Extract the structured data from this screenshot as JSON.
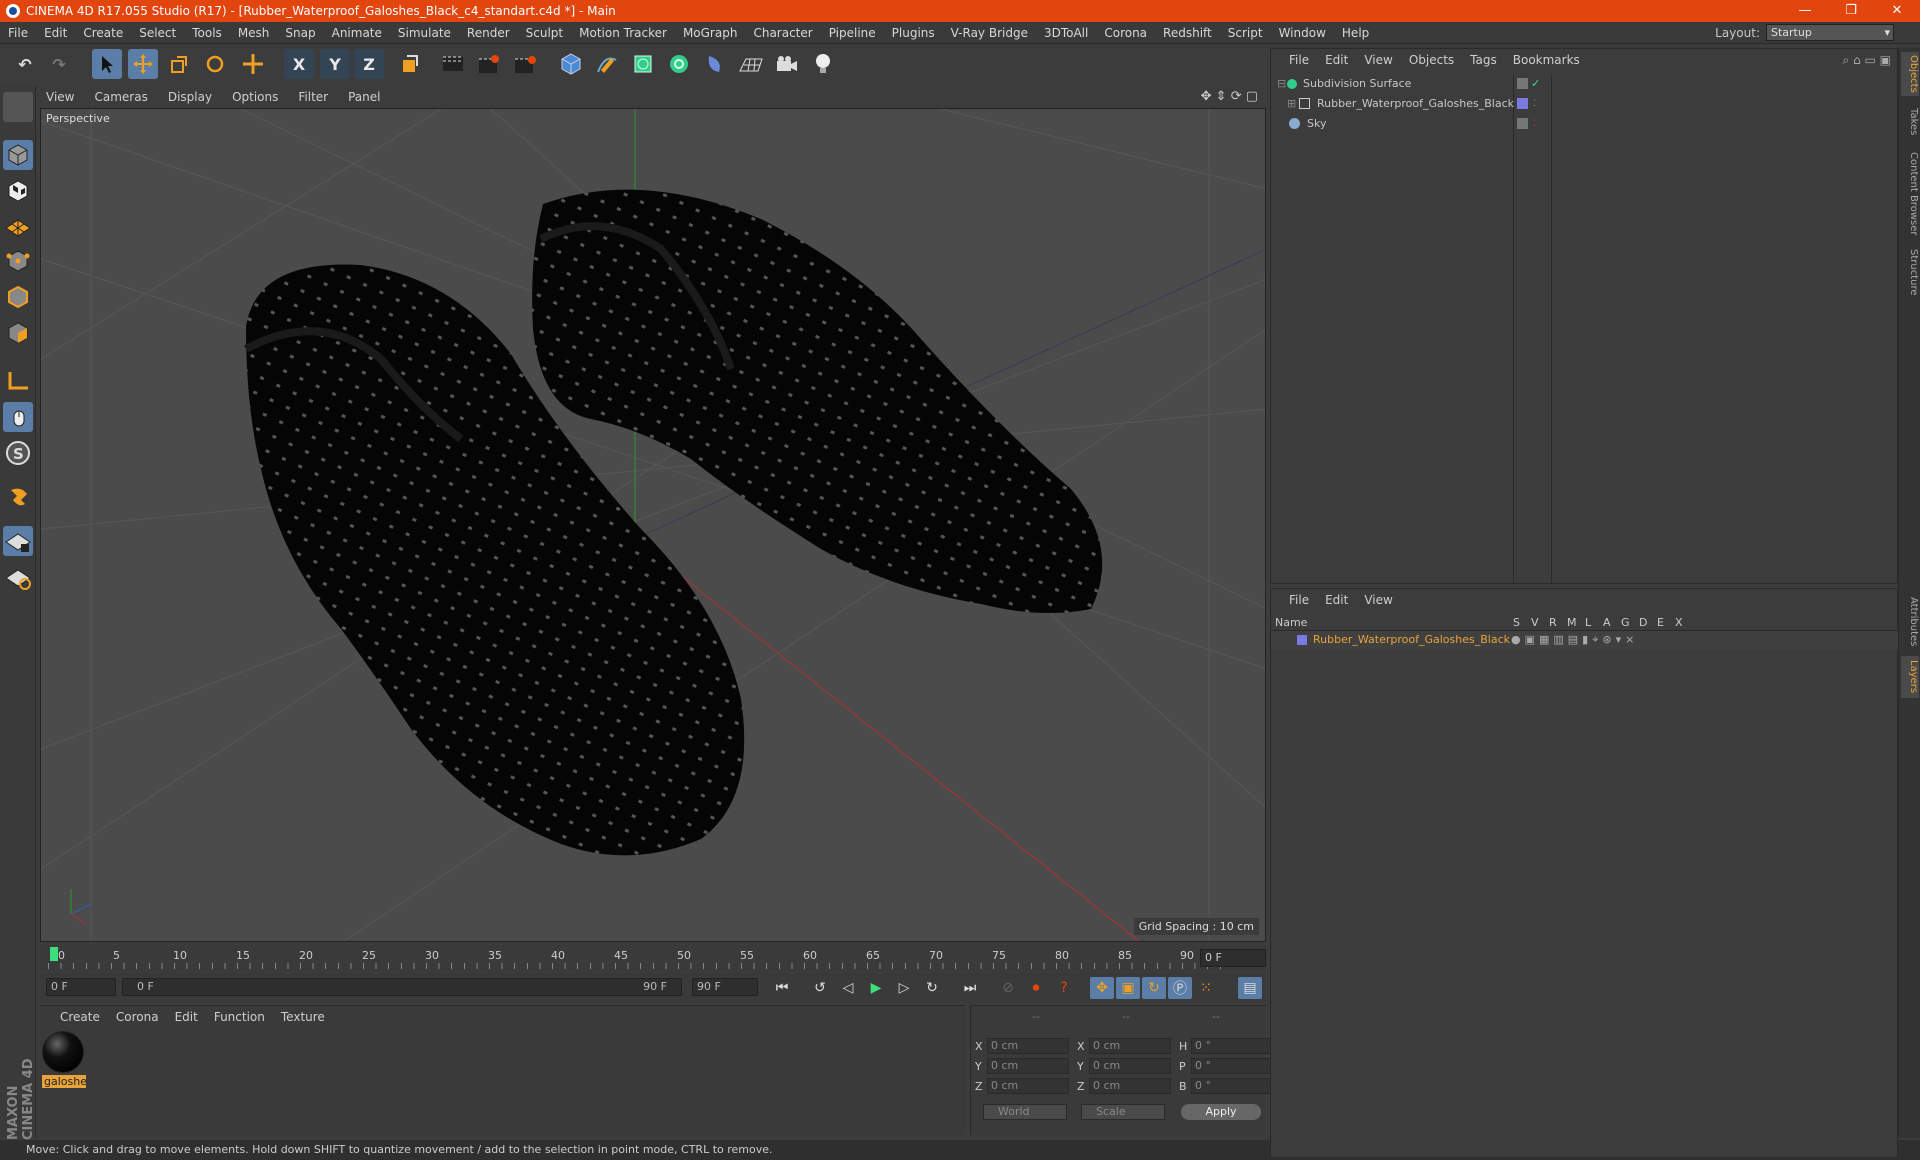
{
  "window": {
    "title": "CINEMA 4D R17.055 Studio (R17) - [Rubber_Waterproof_Galoshes_Black_c4_standart.c4d *] - Main",
    "minimize": "—",
    "restore": "❐",
    "close": "✕"
  },
  "menu": [
    "File",
    "Edit",
    "Create",
    "Select",
    "Tools",
    "Mesh",
    "Snap",
    "Animate",
    "Simulate",
    "Render",
    "Sculpt",
    "Motion Tracker",
    "MoGraph",
    "Character",
    "Pipeline",
    "Plugins",
    "V-Ray Bridge",
    "3DToAll",
    "Corona",
    "Redshift",
    "Script",
    "Window",
    "Help"
  ],
  "layout": {
    "label": "Layout:",
    "value": "Startup"
  },
  "toolbar": {
    "x": "X",
    "y": "Y",
    "z": "Z"
  },
  "viewport": {
    "menu": [
      "View",
      "Cameras",
      "Display",
      "Options",
      "Filter",
      "Panel"
    ],
    "label": "Perspective",
    "grid_spacing": "Grid Spacing : 10 cm"
  },
  "timeline": {
    "ticks": [
      "0",
      "5",
      "10",
      "15",
      "20",
      "25",
      "30",
      "35",
      "40",
      "45",
      "50",
      "55",
      "60",
      "65",
      "70",
      "75",
      "80",
      "85",
      "90"
    ],
    "current_frame": "0 F",
    "start": "0 F",
    "range_start": "0 F",
    "range_end": "90 F",
    "end": "90 F"
  },
  "material_panel": {
    "menu": [
      "Create",
      "Corona",
      "Edit",
      "Function",
      "Texture"
    ],
    "material_name": "galoshe"
  },
  "coords": {
    "header": [
      "--",
      "--",
      "--"
    ],
    "rows": [
      {
        "a": "X",
        "av": "0 cm",
        "b": "X",
        "bv": "0 cm",
        "c": "H",
        "cv": "0 °"
      },
      {
        "a": "Y",
        "av": "0 cm",
        "b": "Y",
        "bv": "0 cm",
        "c": "P",
        "cv": "0 °"
      },
      {
        "a": "Z",
        "av": "0 cm",
        "b": "Z",
        "bv": "0 cm",
        "c": "B",
        "cv": "0 °"
      }
    ],
    "world": "World",
    "scale": "Scale",
    "apply": "Apply"
  },
  "status": "Move: Click and drag to move elements. Hold down SHIFT to quantize movement / add to the selection in point mode, CTRL to remove.",
  "objects_panel": {
    "menu": [
      "File",
      "Edit",
      "View",
      "Objects",
      "Tags",
      "Bookmarks"
    ],
    "items": [
      {
        "name": "Subdivision Surface"
      },
      {
        "name": "Rubber_Waterproof_Galoshes_Black"
      },
      {
        "name": "Sky"
      }
    ]
  },
  "layers_panel": {
    "menu": [
      "File",
      "Edit",
      "View"
    ],
    "columns": [
      "Name",
      "S",
      "V",
      "R",
      "M",
      "L",
      "A",
      "G",
      "D",
      "E",
      "X"
    ],
    "row": "Rubber_Waterproof_Galoshes_Black"
  },
  "side_tabs": [
    "Objects",
    "Takes",
    "Content Browser",
    "Structure",
    "Attributes",
    "Layers"
  ],
  "brand": "MAXON CINEMA 4D",
  "colors": {
    "title_bar": "#e2450e",
    "accent": "#e8a33a",
    "active_tool": "#5a7ea8"
  }
}
